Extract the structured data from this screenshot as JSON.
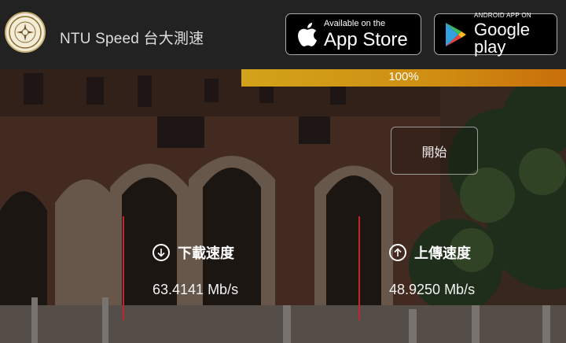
{
  "header": {
    "title": "NTU Speed 台大測速",
    "logo_icon": "ntu-seal-logo"
  },
  "stores": {
    "appstore": {
      "small": "Available on the",
      "big": "App Store",
      "icon": "apple-icon"
    },
    "googleplay": {
      "small": "ANDROID APP ON",
      "big": "Google play",
      "icon": "google-play-icon"
    }
  },
  "progress": {
    "label": "100%",
    "value": 1.0,
    "color_start": "#d3a31a",
    "color_end": "#c86f0a"
  },
  "controls": {
    "start_label": "開始"
  },
  "download": {
    "label": "下載速度",
    "value": "63.4141 Mb/s",
    "icon": "arrow-down-circle-icon"
  },
  "upload": {
    "label": "上傳速度",
    "value": "48.9250 Mb/s",
    "icon": "arrow-up-circle-icon"
  },
  "colors": {
    "divider": "#c0272d",
    "header_bg": "#222222"
  }
}
